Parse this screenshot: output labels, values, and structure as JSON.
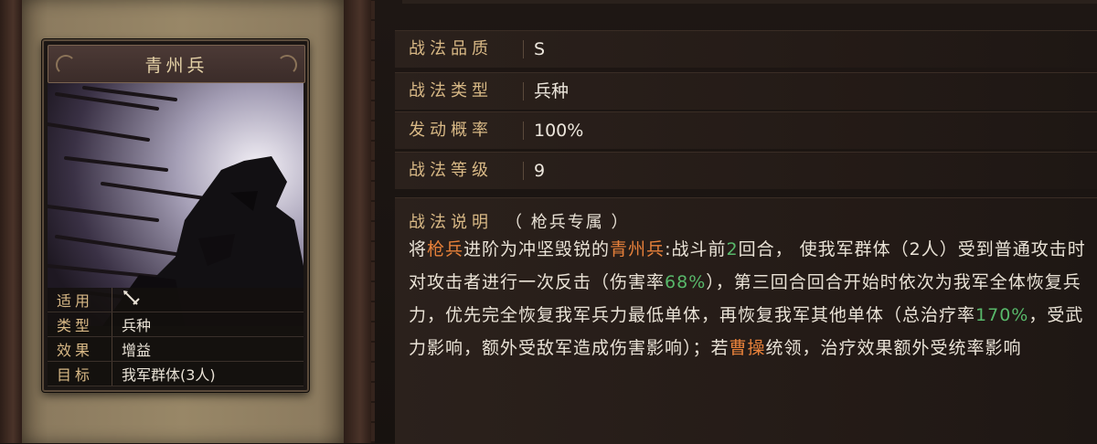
{
  "card": {
    "title": "青州兵",
    "info": [
      {
        "key": "适用",
        "value": ""
      },
      {
        "key": "类型",
        "value": "兵种"
      },
      {
        "key": "效果",
        "value": "增益"
      },
      {
        "key": "目标",
        "value": "我军群体(3人)"
      }
    ],
    "applies_icon": "spear-icon"
  },
  "properties": [
    {
      "label": "战法品质",
      "value": "S"
    },
    {
      "label": "战法类型",
      "value": "兵种"
    },
    {
      "label": "发动概率",
      "value": "100%"
    },
    {
      "label": "战法等级",
      "value": "9"
    }
  ],
  "description": {
    "label": "战法说明",
    "tag": "（ 枪兵专属 ）",
    "segments": {
      "s1": "将",
      "s2": "枪兵",
      "s3": "进阶为冲坚毁锐的",
      "s4": "青州兵",
      "s5": ":战斗前",
      "s6": "2",
      "s7": "回合，  使我军群体（2人）受到普通攻击时对攻击者进行一次反击（伤害率",
      "s8": "68%",
      "s9": "），第三回合回合开始时依次为我军全体恢复兵力，优先完全恢复我军兵力最低单体，再恢复我军其他单体（总治疗率",
      "s10": "170%",
      "s11": "，受武力影响，额外受敌军造成伤害影响）；若",
      "s12": "曹操",
      "s13": "统领，治疗效果额外受统率影响"
    }
  },
  "colors": {
    "label_gold": "#d9b986",
    "highlight_orange": "#e6803a",
    "highlight_green": "#58b86a"
  }
}
